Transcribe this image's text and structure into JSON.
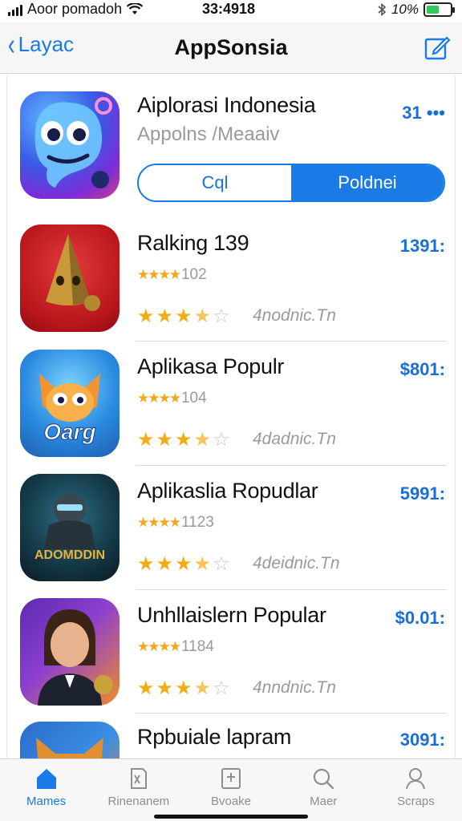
{
  "status_bar": {
    "carrier": "Aoor pomadoh",
    "time": "33:4918",
    "battery_text": "10%",
    "battery_level": 0.55
  },
  "nav": {
    "back_label": "Layac",
    "title": "AppSonsia"
  },
  "featured": {
    "name": "Aiplorasi Indonesia",
    "subtitle": "Appolns /Meaaiv",
    "price": "31 •••",
    "segment_a": "Cql",
    "segment_b": "Poldnei"
  },
  "apps": [
    {
      "name": "Ralking 139",
      "price": "1391:",
      "rating_small": "102",
      "meta": "4nodnic.Tn",
      "stars": 3.5
    },
    {
      "name": "Aplikasa Populr",
      "price": "$801:",
      "rating_small": "104",
      "meta": "4dadnic.Tn",
      "stars": 3.5
    },
    {
      "name": "Aplikaslia Ropudlar",
      "price": "5991:",
      "rating_small": "1123",
      "meta": "4deidnic.Tn",
      "stars": 3.5
    },
    {
      "name": "Unhllaislern Popular",
      "price": "$0.01:",
      "rating_small": "1184",
      "meta": "4nndnic.Tn",
      "stars": 3.5
    },
    {
      "name": "Rpbuiale lapram",
      "price": "3091:"
    }
  ],
  "icon_texts": {
    "app2": "Oarg",
    "app3": "ADOMDDIN"
  },
  "tabs": [
    {
      "label": "Mames",
      "icon": "home-icon",
      "active": true
    },
    {
      "label": "Rinenanem",
      "icon": "book-icon",
      "active": false
    },
    {
      "label": "Bvoake",
      "icon": "box-icon",
      "active": false
    },
    {
      "label": "Maer",
      "icon": "search-icon",
      "active": false
    },
    {
      "label": "Scraps",
      "icon": "person-icon",
      "active": false
    }
  ],
  "colors": {
    "accent": "#1a7ae6",
    "star": "#f4ac15",
    "battery": "#34c759"
  }
}
